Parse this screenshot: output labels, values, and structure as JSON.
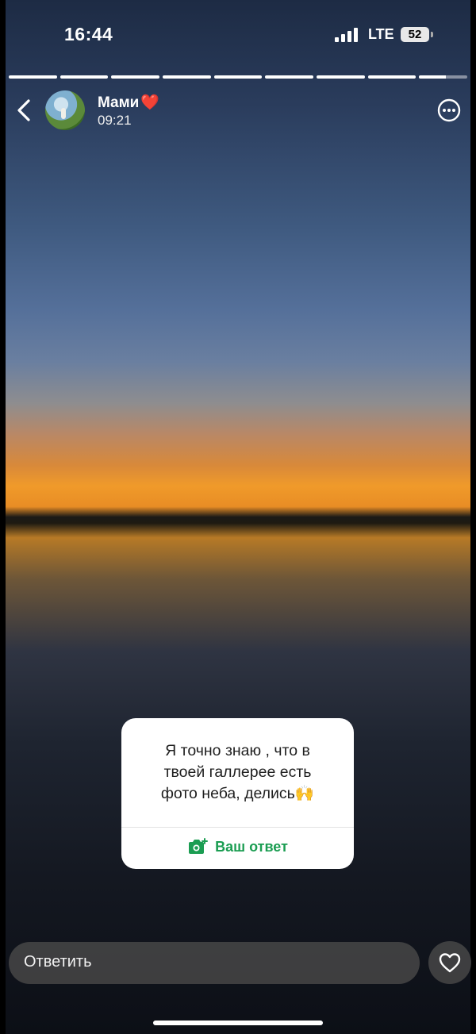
{
  "status_bar": {
    "time": "16:44",
    "network": "LTE",
    "battery": "52",
    "signal_icon": "cellular-signal-icon"
  },
  "story": {
    "segments_total": 9,
    "current_segment_progress": 0.55,
    "user_name": "Мами",
    "user_emoji": "❤️",
    "time_posted": "09:21",
    "more_icon": "ellipsis-circle-icon",
    "back_icon": "chevron-left-icon"
  },
  "question_sticker": {
    "line1": "Я точно знаю , что в",
    "line2": "твоей галлерее есть",
    "line3": "фото неба, делись🙌",
    "answer_label": "Ваш ответ",
    "answer_icon": "camera-plus-icon",
    "accent": "#1b9d52"
  },
  "footer": {
    "reply_placeholder": "Ответить",
    "like_icon": "heart-outline-icon"
  }
}
